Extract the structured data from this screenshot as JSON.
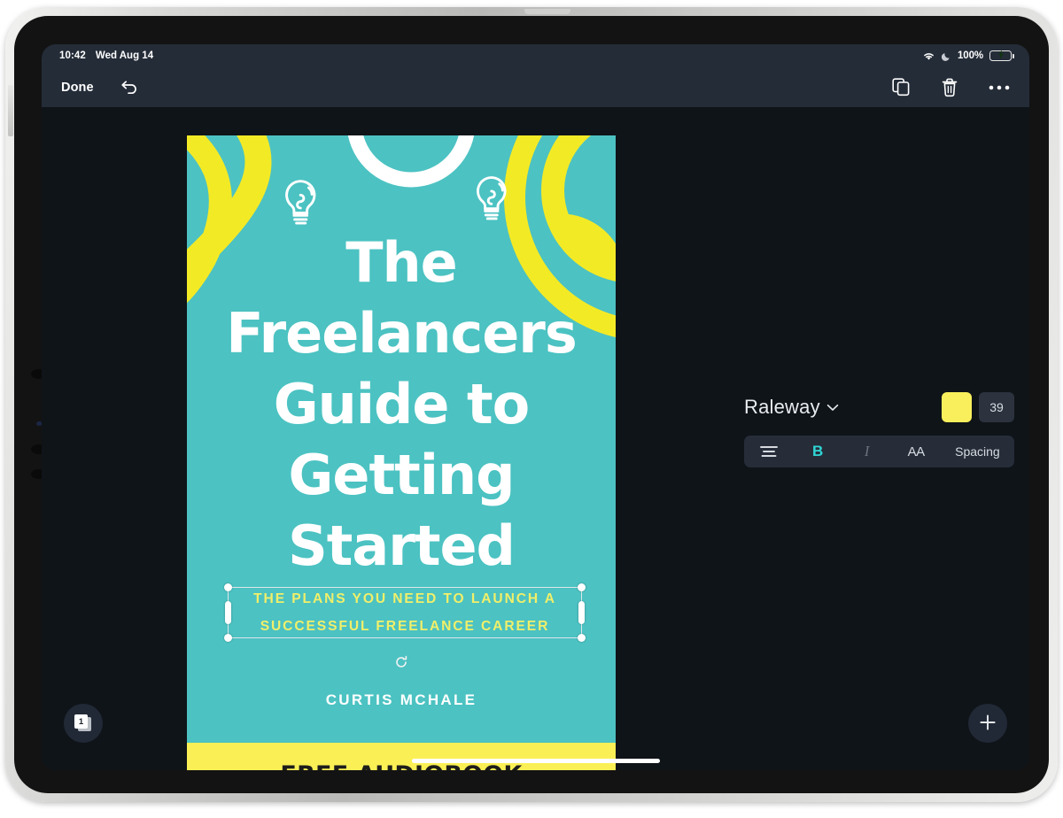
{
  "status_bar": {
    "time": "10:42",
    "date": "Wed Aug 14",
    "wifi_icon": "wifi-icon",
    "dnd_icon": "moon-icon",
    "battery_percent": "100%",
    "battery_icon": "battery-charging-icon",
    "battery_color": "#34c759"
  },
  "toolbar": {
    "done_label": "Done",
    "undo_icon": "undo-icon",
    "duplicate_icon": "duplicate-icon",
    "delete_icon": "trash-icon",
    "more_icon": "more-horizontal-icon"
  },
  "cover": {
    "background_color": "#4cc2c2",
    "accent_color": "#faf055",
    "title": "The\nFreelancers\nGuide to\nGetting\nStarted",
    "subtitle": "THE PLANS YOU NEED TO LAUNCH A\nSUCCESSFUL FREELANCE CAREER",
    "subtitle_color": "#f0ef6a",
    "author": "CURTIS MCHALE",
    "banner_text": "FREE AUDIOBOOK",
    "banner_color": "#faf055",
    "banner_text_color": "#1d1d1b",
    "decor": {
      "bulb_left_icon": "lightbulb-icon",
      "bulb_right_icon": "lightbulb-icon",
      "swirl_icon": "swirl-decoration"
    },
    "selection": {
      "rotate_icon": "rotate-handle-icon",
      "handle_icon": "resize-handle"
    }
  },
  "inspector": {
    "font_name": "Raleway",
    "font_dropdown_icon": "chevron-down-icon",
    "color_swatch": "#f9ef5c",
    "font_size": "39",
    "format": {
      "align_icon": "align-center-icon",
      "bold_label": "B",
      "bold_active_color": "#2fd6d6",
      "italic_label": "I",
      "case_label": "AA",
      "spacing_label": "Spacing"
    }
  },
  "floating": {
    "pages_count": "1",
    "pages_icon": "pages-icon",
    "add_icon": "plus-icon"
  }
}
